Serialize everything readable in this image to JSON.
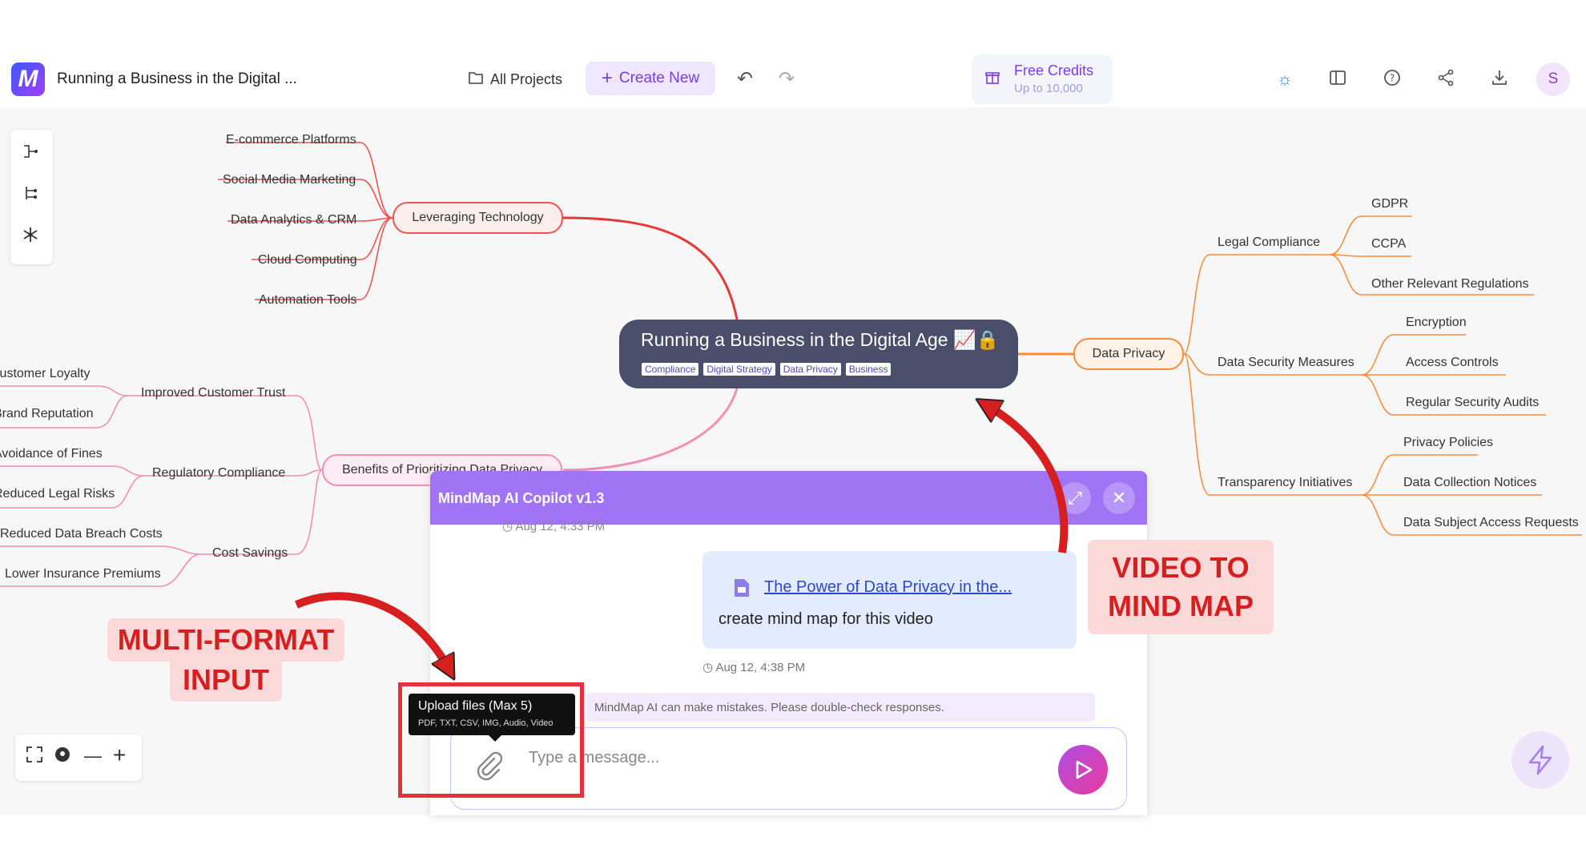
{
  "header": {
    "logo_letter": "M",
    "doc_title": "Running a Business in the Digital ...",
    "all_projects": "All Projects",
    "create_new": "Create New",
    "credits_title": "Free Credits",
    "credits_sub": "Up to 10,000",
    "avatar_initial": "S"
  },
  "mindmap": {
    "root": {
      "title": "Running a Business in the Digital Age 📈🔒",
      "tags": [
        "Compliance",
        "Digital Strategy",
        "Data Privacy",
        "Business"
      ]
    },
    "tech": {
      "label": "Leveraging Technology",
      "children": [
        "E-commerce Platforms",
        "Social Media Marketing",
        "Data Analytics & CRM",
        "Cloud Computing",
        "Automation Tools"
      ]
    },
    "benefits": {
      "label": "Benefits of Prioritizing Data Privacy",
      "groups": [
        {
          "label": "Improved Customer Trust",
          "children": [
            "Customer Loyalty",
            "Brand Reputation"
          ]
        },
        {
          "label": "Regulatory Compliance",
          "children": [
            "Avoidance of Fines",
            "Reduced Legal Risks"
          ]
        },
        {
          "label": "Cost Savings",
          "children": [
            "Reduced Data Breach Costs",
            "Lower Insurance Premiums"
          ]
        }
      ]
    },
    "privacy": {
      "label": "Data Privacy",
      "groups": [
        {
          "label": "Legal Compliance",
          "children": [
            "GDPR",
            "CCPA",
            "Other Relevant Regulations"
          ]
        },
        {
          "label": "Data Security Measures",
          "children": [
            "Encryption",
            "Access Controls",
            "Regular Security Audits"
          ]
        },
        {
          "label": "Transparency Initiatives",
          "children": [
            "Privacy Policies",
            "Data Collection Notices",
            "Data Subject Access Requests"
          ]
        }
      ]
    }
  },
  "copilot": {
    "title": "MindMap AI Copilot v1.3",
    "prev_timestamp": "Aug 12, 4:33 PM",
    "attachment_link": "The Power of Data Privacy in the...",
    "message": "create mind map for this video",
    "timestamp": "Aug 12, 4:38 PM",
    "disclaimer": "MindMap AI can make mistakes. Please double-check responses.",
    "input_placeholder": "Type a message..."
  },
  "tooltip": {
    "title": "Upload files (Max 5)",
    "formats": "PDF, TXT, CSV, IMG, Audio, Video"
  },
  "callouts": {
    "left": "MULTI-FORMAT\nINPUT",
    "left_line1": "MULTI-FORMAT",
    "left_line2": "INPUT",
    "right_line1": "VIDEO TO",
    "right_line2": "MIND MAP"
  },
  "colors": {
    "accent": "#7a3cf0",
    "panel_header": "#a173f5",
    "root_bg": "#4b4e6a",
    "branch_tech": "#ef5350",
    "branch_benefits": "#f48fb1",
    "branch_privacy": "#fb8c3c",
    "annotation_red": "#d81f1f"
  }
}
